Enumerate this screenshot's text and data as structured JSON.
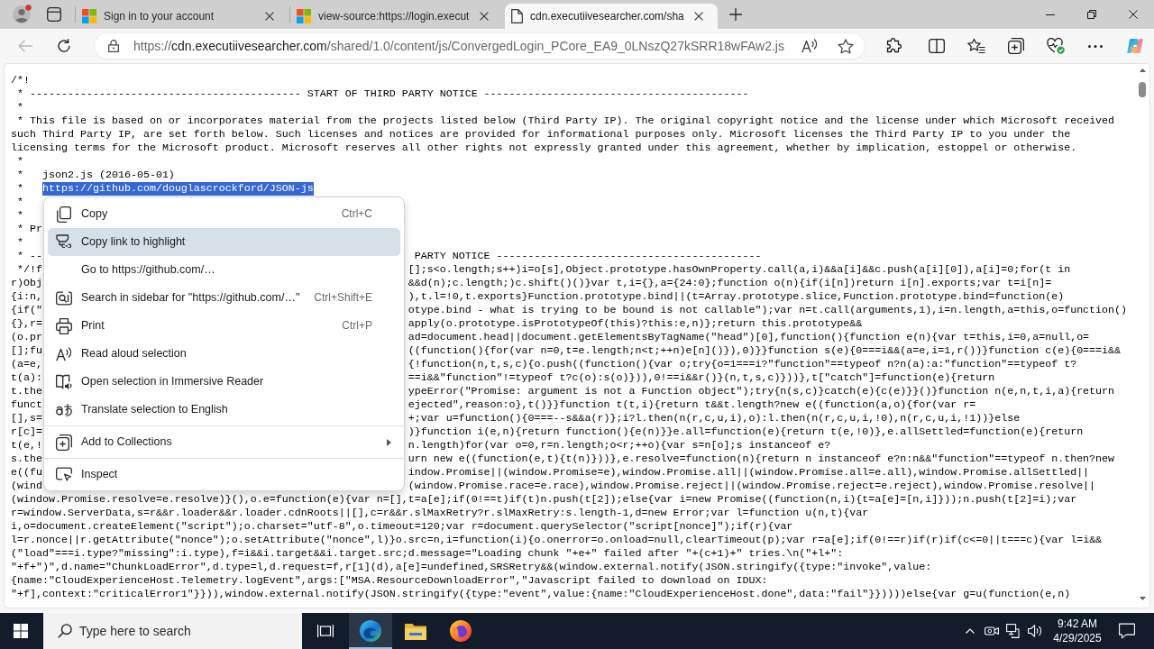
{
  "browser": {
    "tabs": [
      {
        "title": "Sign in to your account",
        "selected": false
      },
      {
        "title": "view-source:https://login.execut",
        "selected": false
      },
      {
        "title": "cdn.executiivesearcher.com/sha",
        "selected": true
      }
    ],
    "toolbar": {
      "back_button": {
        "disabled": true
      },
      "address": {
        "scheme": "https://",
        "host": "cdn.executiivesearcher.com",
        "path": "/shared/1.0/content/js/ConvergedLogin_PCore_EA9_0LNszQ27kSRR18wFAw2.js"
      }
    }
  },
  "page": {
    "code_lines": [
      {
        "kind": "line",
        "text": "/*!"
      },
      {
        "kind": "line",
        "text": " * ------------------------------------------- START OF THIRD PARTY NOTICE ------------------------------------------"
      },
      {
        "kind": "line",
        "text": " *"
      },
      {
        "kind": "line",
        "text": " * This file is based on or incorporates material from the projects listed below (Third Party IP). The original copyright notice and the license under which Microsoft received"
      },
      {
        "kind": "line",
        "text": "such Third Party IP, are set forth below. Such licenses and notices are provided for informational purposes only. Microsoft licenses the Third Party IP to you under the"
      },
      {
        "kind": "line",
        "text": "licensing terms for the Microsoft product. Microsoft reserves all other rights not expressly granted under this agreement, whether by implication, estoppel or otherwise."
      },
      {
        "kind": "line",
        "text": " *"
      },
      {
        "kind": "line",
        "text": " *   json2.js (2016-05-01)"
      },
      {
        "kind": "selection",
        "text": " *   ",
        "selection": "https://github.com/douglascrockford/JSON-js"
      },
      {
        "kind": "line",
        "text": " *"
      },
      {
        "kind": "line",
        "text": " *"
      },
      {
        "kind": "covered",
        "start": " * Pr"
      },
      {
        "kind": "line",
        "text": " *"
      },
      {
        "kind": "covered",
        "start": " * --",
        "end": " PARTY NOTICE ------------------------------------------"
      },
      {
        "kind": "covered",
        "start": " */!f",
        "end": "[];s<o.length;s++)i=o[s],Object.prototype.hasOwnProperty.call(a,i)&&a[i]&&c.push(a[i][0]),a[i]=0;for(t in"
      },
      {
        "kind": "covered",
        "start": "r)Obj",
        "end": "&&d(n);c.length;)c.shift()()}var t,i={},a={24:0};function o(n){if(i[n])return i[n].exports;var t=i[n]="
      },
      {
        "kind": "covered",
        "start": "{i:n,",
        "end": "),t.l=!0,t.exports}Function.prototype.bind||(t=Array.prototype.slice,Function.prototype.bind=function(e)"
      },
      {
        "kind": "covered",
        "start": "{if(\"",
        "end": "otype.bind - what is trying to be bound is not callable\");var n=t.call(arguments,1),i=n.length,a=this,o=function()"
      },
      {
        "kind": "covered",
        "start": "{},r=",
        "end": "apply(o.prototype.isPrototypeOf(this)?this:e,n)};return this.prototype&&"
      },
      {
        "kind": "covered",
        "start": "(o.pr",
        "end": "ad=document.head||document.getElementsByTagName(\"head\")[0],function(){function e(n){var t=this,i=0,a=null,o="
      },
      {
        "kind": "covered",
        "start": "[];fu",
        "end": "((function(){for(var n=0,t=e.length;n<t;++n)e[n]()}),0)}}function s(e){0===i&&(a=e,i=1,r())}function c(e){0===i&&"
      },
      {
        "kind": "covered",
        "start": "(a=e,",
        "end": "{!function(n,t,s,c){o.push((function(){var o;try{o=1===i?\"function\"==typeof n?n(a):a:\"function\"==typeof t?"
      },
      {
        "kind": "covered",
        "start": "t(a):",
        "end": "==i&&\"function\"!=typeof t?c(o):s(o)})),0!==i&&r()}(n,t,s,c)}))},t[\"catch\"]=function(e){return"
      },
      {
        "kind": "covered",
        "start": "t.the",
        "end": "ypeError(\"Promise: argument is not a Function object\");try{n(s,c)}catch(e){c(e)}}()}function n(e,n,t,i,a){return"
      },
      {
        "kind": "covered",
        "start": "funct",
        "end": "ejected\",reason:o},t()}}function t(t,i){return t&&t.length?new e((function(a,o){for(var r="
      },
      {
        "kind": "covered",
        "start": "[],s=",
        "end": "+;var u=function(){0===--s&&a(r)};i?l.then(n(r,c,u,i),o):l.then(n(r,c,u,i,!0),n(r,c,u,i,!1))}else"
      },
      {
        "kind": "covered",
        "start": "r[c]=",
        "end": ")}function i(e,n){return function(){e(n)}}e.all=function(e){return t(e,!0)},e.allSettled=function(e){return"
      },
      {
        "kind": "covered",
        "start": "t(e,!",
        "end": "n.length)for(var o=0,r=n.length;o<r;++o){var s=n[o];s instanceof e?"
      },
      {
        "kind": "covered",
        "start": "s.the",
        "end": "urn new e((function(e,t){t(n)}))},e.resolve=function(n){return n instanceof e?n:n&&\"function\"==typeof n.then?new"
      },
      {
        "kind": "covered",
        "start": "e((fu",
        "end": "indow.Promise||(window.Promise=e),window.Promise.all||(window.Promise.all=e.all),window.Promise.allSettled||"
      },
      {
        "kind": "covered",
        "start": "(wind",
        "end": "(window.Promise.race=e.race),window.Promise.reject||(window.Promise.reject=e.reject),window.Promise.resolve||"
      },
      {
        "kind": "line",
        "text": "(window.Promise.resolve=e.resolve)}(),o.e=function(e){var n=[],t=a[e];if(0!==t)if(t)n.push(t[2]);else{var i=new Promise((function(n,i){t=a[e]=[n,i]}));n.push(t[2]=i);var"
      },
      {
        "kind": "line",
        "text": "r=window.ServerData,s=r&&r.loader&&r.loader.cdnRoots||[],c=r&&r.slMaxRetry?r.slMaxRetry:s.length-1,d=new Error;var l=function u(n,t){var"
      },
      {
        "kind": "line",
        "text": "i,o=document.createElement(\"script\");o.charset=\"utf-8\",o.timeout=120;var r=document.querySelector(\"script[nonce]\");if(r){var"
      },
      {
        "kind": "line",
        "text": "l=r.nonce||r.getAttribute(\"nonce\");o.setAttribute(\"nonce\",l)}o.src=n,i=function(i){o.onerror=o.onload=null,clearTimeout(p);var r=a[e];if(0!==r)if(r)if(c<=0||t===c){var l=i&&"
      },
      {
        "kind": "line",
        "text": "(\"load\"===i.type?\"missing\":i.type),f=i&&i.target&&i.target.src;d.message=\"Loading chunk \"+e+\" failed after \"+(c+1)+\" tries.\\n(\"+l+\":"
      },
      {
        "kind": "line",
        "text": "\"+f+\")\",d.name=\"ChunkLoadError\",d.type=l,d.request=f,r[1](d),a[e]=undefined,SRSRetry&&(window.external.notify(JSON.stringify({type:\"invoke\",value:"
      },
      {
        "kind": "line",
        "text": "{name:\"CloudExperienceHost.Telemetry.logEvent\",args:[\"MSA.ResourceDownloadError\",\"Javascript failed to download on IDUX:"
      },
      {
        "kind": "line",
        "text": "\"+f],context:\"criticalError1\"}})),window.external.notify(JSON.stringify({type:\"event\",value:{name:\"CloudExperienceHost.done\",data:\"fail\"}}))))else{var g=u(function(e,n)"
      }
    ]
  },
  "context_menu": {
    "items": [
      {
        "kind": "action",
        "label": "Copy",
        "shortcut": "Ctrl+C",
        "selected": false
      },
      {
        "kind": "action",
        "label": "Copy link to highlight",
        "selected": true
      },
      {
        "kind": "action",
        "label": "Go to https://github.com/…",
        "selected": false
      },
      {
        "kind": "action",
        "label": "Search in sidebar for \"https://github.com/…\"",
        "shortcut": "Ctrl+Shift+E",
        "selected": false
      },
      {
        "kind": "action",
        "label": "Print",
        "shortcut": "Ctrl+P",
        "selected": false
      },
      {
        "kind": "action",
        "label": "Read aloud selection",
        "selected": false
      },
      {
        "kind": "action",
        "label": "Open selection in Immersive Reader",
        "selected": false
      },
      {
        "kind": "action",
        "label": "Translate selection to English",
        "selected": false
      },
      {
        "kind": "separator"
      },
      {
        "kind": "submenu",
        "label": "Add to Collections",
        "selected": false
      },
      {
        "kind": "separator"
      },
      {
        "kind": "action",
        "label": "Inspect",
        "selected": false
      }
    ]
  },
  "taskbar": {
    "search": {
      "placeholder": "Type here to search"
    },
    "apps": [
      {
        "active": true
      },
      {
        "active": false
      },
      {
        "active": false
      }
    ],
    "clock": {
      "time": "9:42 AM",
      "date": "4/29/2025"
    }
  }
}
